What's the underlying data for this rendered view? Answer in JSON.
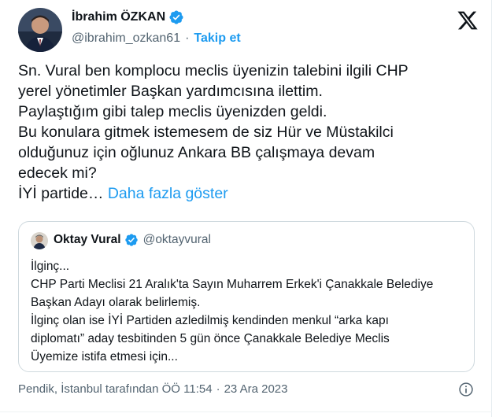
{
  "author": {
    "name": "İbrahim ÖZKAN",
    "handle": "@ibrahim_ozkan61",
    "separator": "·",
    "follow_label": "Takip et",
    "verified_color": "#1d9bf0"
  },
  "tweet": {
    "lines": [
      "Sn. Vural ben komplocu meclis üyenizin talebini ilgili CHP",
      "yerel yönetimler Başkan yardımcısına ilettim.",
      "Paylaştığım gibi talep meclis üyenizden geldi.",
      "Bu konulara gitmek istemesem de siz Hür ve Müstakilci",
      "olduğunuz için oğlunuz Ankara BB çalışmaya devam",
      "edecek mi?"
    ],
    "last_line": "İYİ partide…",
    "more_label": "Daha fazla göster"
  },
  "quote": {
    "name": "Oktay Vural",
    "handle": "@oktayvural",
    "lines": [
      "İlginç...",
      "CHP Parti Meclisi 21 Aralık'ta Sayın Muharrem Erkek'i Çanakkale Belediye",
      "Başkan Adayı olarak belirlemiş.",
      "İlginç olan ise İYİ Partiden azledilmiş kendinden menkul “arka kapı",
      "diplomatı” aday tesbitinden 5 gün önce Çanakkale Belediye Meclis",
      "Üyemize istifa etmesi için..."
    ]
  },
  "meta": {
    "location": "Pendik, İstanbul tarafından",
    "time": "ÖÖ 11:54",
    "separator": "·",
    "date": "23 Ara 2023"
  },
  "icons": {
    "x_logo": "x-logo-icon",
    "verified": "verified-badge-icon",
    "info": "info-icon"
  },
  "colors": {
    "accent": "#1d9bf0",
    "text": "#0f1419",
    "secondary": "#536471",
    "border": "#cfd9de"
  }
}
